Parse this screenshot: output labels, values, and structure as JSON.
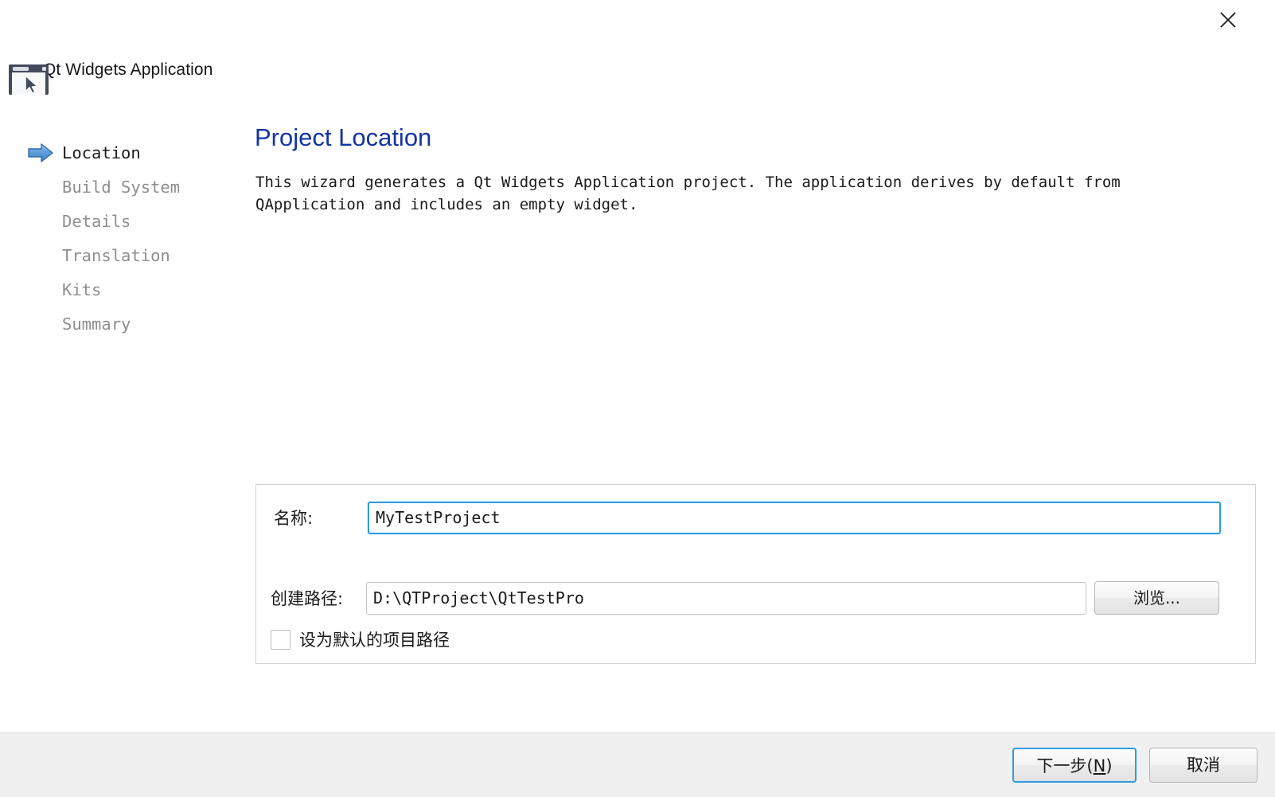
{
  "window": {
    "title": "Qt Widgets Application",
    "icon": "qt-widgets-application-icon",
    "close_icon": "close-icon"
  },
  "sidebar": {
    "steps": [
      {
        "label": "Location",
        "state": "active"
      },
      {
        "label": "Build System",
        "state": "pending"
      },
      {
        "label": "Details",
        "state": "pending"
      },
      {
        "label": "Translation",
        "state": "pending"
      },
      {
        "label": "Kits",
        "state": "pending"
      },
      {
        "label": "Summary",
        "state": "pending"
      }
    ],
    "active_arrow_icon": "blue-arrow-right-icon"
  },
  "page": {
    "title": "Project Location",
    "description": "This wizard generates a Qt Widgets Application project. The application derives by default from QApplication and includes an empty widget."
  },
  "form": {
    "name": {
      "label": "名称:",
      "value": "MyTestProject",
      "placeholder": ""
    },
    "path": {
      "label": "创建路径:",
      "value": "D:\\QTProject\\QtTestPro",
      "placeholder": "",
      "browse_label": "浏览..."
    },
    "default_path_checkbox": {
      "label": "设为默认的项目路径",
      "checked": false
    }
  },
  "footer": {
    "next_label_pre": "下一步(",
    "next_accel": "N",
    "next_label_post": ")",
    "cancel_label": "取消"
  },
  "colors": {
    "title_blue": "#1434a4",
    "focus_blue": "#2d9ce0",
    "footer_bg": "#f0f0f0",
    "step_pending": "#8e8e8e",
    "step_active": "#1d1d1d"
  }
}
